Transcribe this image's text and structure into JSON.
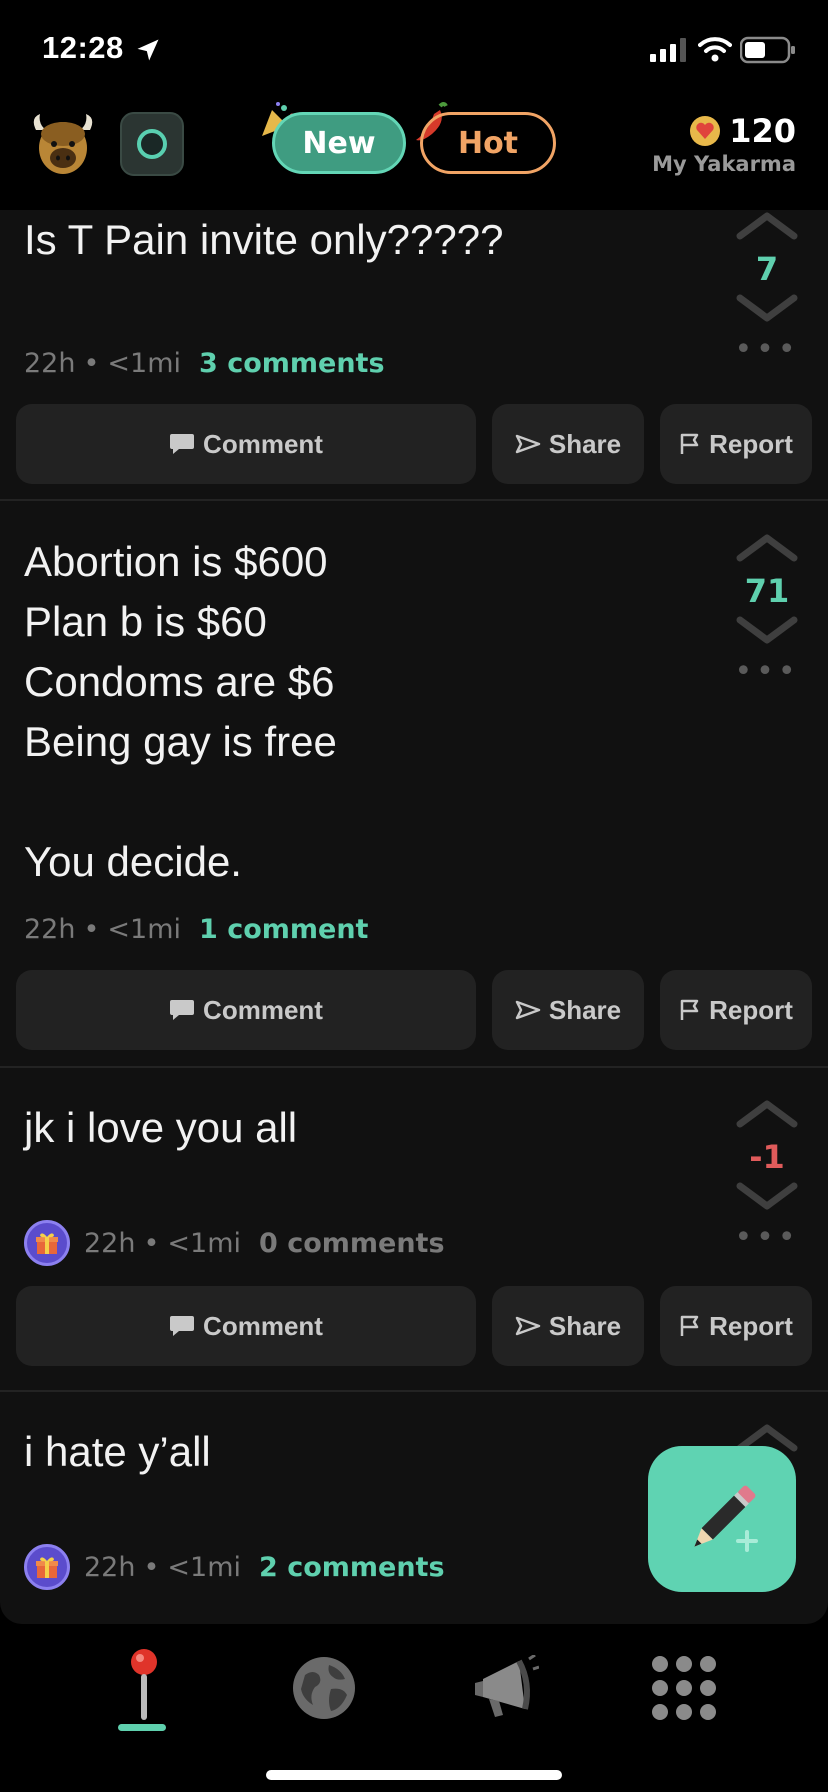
{
  "status_bar": {
    "time": "12:28",
    "icons": [
      "location-arrow-icon",
      "signal-icon",
      "wifi-icon",
      "battery-icon"
    ]
  },
  "header": {
    "tabs": [
      {
        "label": "New",
        "active": true,
        "color": "#5fd0ae"
      },
      {
        "label": "Hot",
        "active": false,
        "color": "#f1a465"
      }
    ],
    "karma": {
      "value": "120",
      "label": "My Yakarma"
    }
  },
  "posts": [
    {
      "text": "Is T Pain invite only?????",
      "time": "22h",
      "distance": "<1mi",
      "comments": "3 comments",
      "score": "7",
      "has_gift": false
    },
    {
      "text": "Abortion is $600\nPlan b is $60\nCondoms are $6\nBeing gay is free\n\nYou decide.",
      "time": "22h",
      "distance": "<1mi",
      "comments": "1 comment",
      "score": "71",
      "has_gift": false
    },
    {
      "text": "jk i love you all",
      "time": "22h",
      "distance": "<1mi",
      "comments": "0 comments",
      "score": "-1",
      "has_gift": true
    },
    {
      "text": "i hate y’all",
      "time": "22h",
      "distance": "<1mi",
      "comments": "2 comments",
      "has_gift": true
    }
  ],
  "actions": {
    "comment": "Comment",
    "share": "Share",
    "report": "Report"
  },
  "meta_separator": "•",
  "colors": {
    "accent": "#5fd0ae",
    "hot": "#f1a465",
    "negative": "#e05b5b",
    "card": "#111111"
  },
  "bottom_nav": [
    {
      "icon": "joystick-pin-icon",
      "active": true
    },
    {
      "icon": "globe-icon",
      "active": false
    },
    {
      "icon": "megaphone-icon",
      "active": false
    },
    {
      "icon": "grid-dots-icon",
      "active": false
    }
  ]
}
